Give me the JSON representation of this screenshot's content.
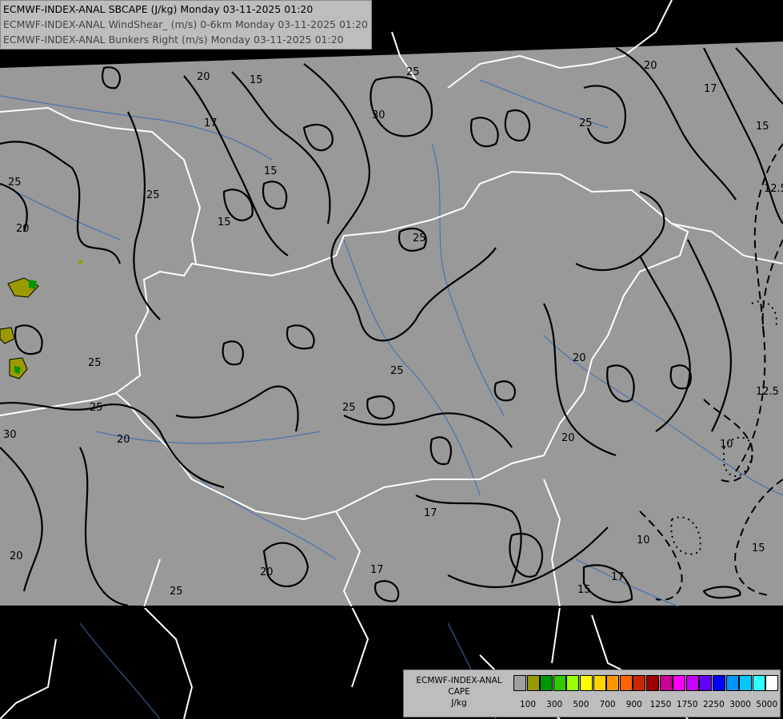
{
  "header": {
    "lines": [
      "ECMWF-INDEX-ANAL SBCAPE (J/kg) Monday 03-11-2025 01:20",
      "ECMWF-INDEX-ANAL WindShear_ (m/s) 0-6km Monday 03-11-2025 01:20",
      "ECMWF-INDEX-ANAL Bunkers Right (m/s) Monday 03-11-2025 01:20"
    ]
  },
  "legend": {
    "title_lines": [
      "ECMWF-INDEX-ANAL",
      "CAPE",
      "J/kg"
    ],
    "colors": [
      "#a0a0a0",
      "#9a9a00",
      "#009600",
      "#32c800",
      "#96ff00",
      "#ffff00",
      "#ffd200",
      "#ff9600",
      "#ff6400",
      "#c82800",
      "#a00000",
      "#c80096",
      "#ff00ff",
      "#c800ff",
      "#6400ff",
      "#0000ff",
      "#0096ff",
      "#00c8ff",
      "#32ffff",
      "#ffffff"
    ],
    "tick_labels": [
      "100",
      "300",
      "500",
      "700",
      "900",
      "1250",
      "1750",
      "2250",
      "3000",
      "5000"
    ]
  },
  "contour_labels": [
    "20",
    "15",
    "25",
    "30",
    "17",
    "25",
    "20",
    "25",
    "15",
    "15",
    "20",
    "12.5",
    "17",
    "15",
    "25",
    "25",
    "25",
    "25",
    "20",
    "25",
    "30",
    "20",
    "20",
    "20",
    "17",
    "17",
    "20",
    "25",
    "15",
    "17",
    "10",
    "10",
    "15",
    "12.5"
  ],
  "colors": {
    "land_gray": "#999999",
    "outside": "#000000",
    "borders": "#ffffff",
    "rivers": "#3a6db0",
    "contours": "#000000"
  }
}
